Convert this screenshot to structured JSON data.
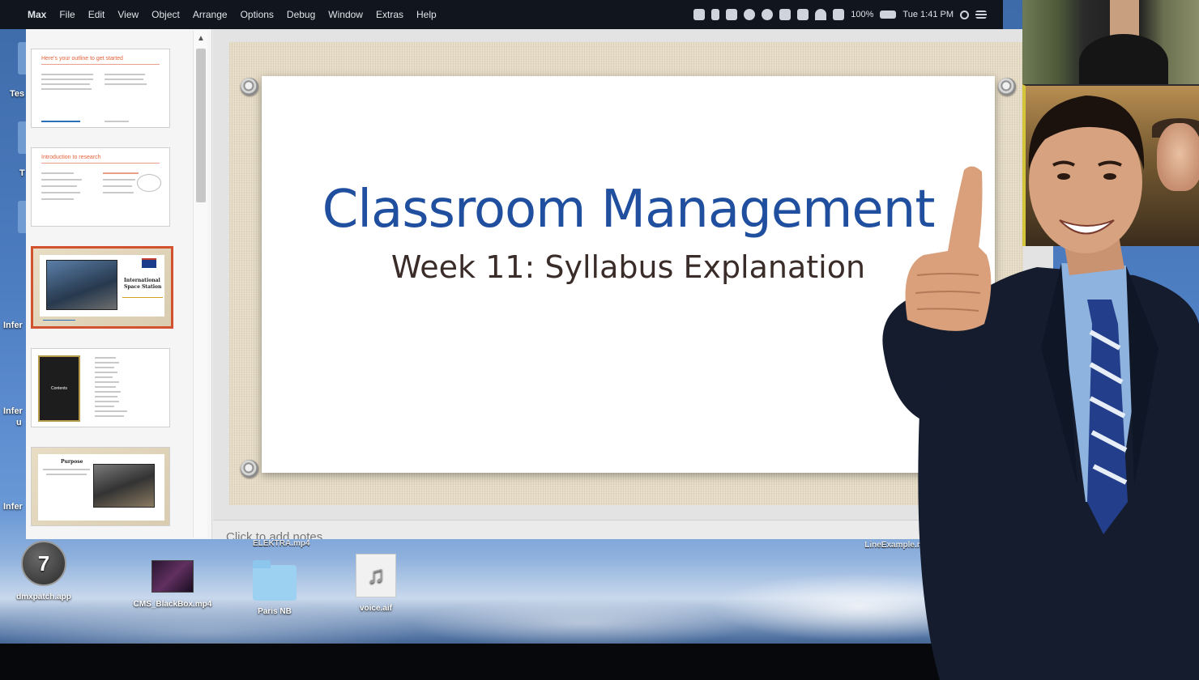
{
  "menubar": {
    "apple": "",
    "items": [
      "Max",
      "File",
      "Edit",
      "View",
      "Object",
      "Arrange",
      "Options",
      "Debug",
      "Window",
      "Extras",
      "Help"
    ],
    "battery": "100%",
    "clock": "Tue 1:41 PM"
  },
  "desktop_edge_labels": [
    "Tes",
    "T",
    "Infer",
    "Infer",
    "u",
    "Infer"
  ],
  "desktop_icons": [
    {
      "label": "dmxpatch.app",
      "glyph": "7"
    },
    {
      "label": "CMS_BlackBox.mp4",
      "glyph": ""
    },
    {
      "label": "Paris NB",
      "glyph": ""
    },
    {
      "label": "voice.aif",
      "glyph": "♫"
    }
  ],
  "ghost_labels": {
    "center": "ELEKTRA.mp4",
    "right": "LineExample.maxpat"
  },
  "navigator": {
    "thumbs": [
      {
        "title": "Here's your outline to get started"
      },
      {
        "title": "Introduction to research"
      },
      {
        "title": "International Space Station"
      },
      {
        "title": "Contents"
      },
      {
        "title": "Purpose"
      }
    ]
  },
  "slide": {
    "title": "Classroom Management",
    "subtitle": "Week 11: Syllabus Explanation"
  },
  "notes": {
    "placeholder": "Click to add notes"
  },
  "colors": {
    "title": "#1f4f9e",
    "subtitle": "#3a2c28",
    "selection": "#d2512e"
  }
}
